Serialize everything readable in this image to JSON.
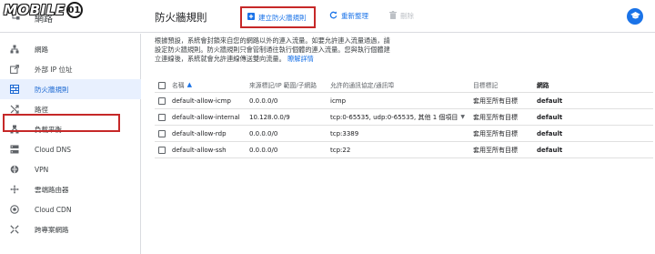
{
  "watermark": {
    "text": "MOBILE",
    "suffix": "01"
  },
  "nav": {
    "header_label": "網路",
    "items": [
      {
        "label": "網路",
        "icon": "network-icon"
      },
      {
        "label": "外部 IP 位址",
        "icon": "external-ip-icon"
      },
      {
        "label": "防火牆規則",
        "icon": "firewall-icon",
        "active": true
      },
      {
        "label": "路徑",
        "icon": "routes-icon"
      },
      {
        "label": "負載平衡",
        "icon": "load-balancing-icon"
      },
      {
        "label": "Cloud DNS",
        "icon": "cloud-dns-icon"
      },
      {
        "label": "VPN",
        "icon": "vpn-icon"
      },
      {
        "label": "雲端路由器",
        "icon": "cloud-router-icon"
      },
      {
        "label": "Cloud CDN",
        "icon": "cloud-cdn-icon"
      },
      {
        "label": "跨專案網路",
        "icon": "shared-vpc-icon"
      }
    ]
  },
  "header": {
    "title": "防火牆規則",
    "create_label": "建立防火牆規則",
    "refresh_label": "重新整理",
    "delete_label": "刪除"
  },
  "description": {
    "text": "根據預設，系統會封鎖來自您的網路以外的連入流量。如要允許連入流量通過，請設定防火牆規則。防火牆規則只會管制通往執行個體的連入流量。您與執行個體建立連線後，系統就會允許連線傳送雙向流量。",
    "link": "瞭解詳情"
  },
  "table": {
    "headers": {
      "name": "名稱",
      "source": "來源標記/IP 範圍/子網路",
      "protocols": "允許的通訊協定/通訊埠",
      "target": "目標標記",
      "network": "網路"
    },
    "rows": [
      {
        "name": "default-allow-icmp",
        "source": "0.0.0.0/0",
        "protocols": "icmp",
        "target": "套用至所有目標",
        "network": "default"
      },
      {
        "name": "default-allow-internal",
        "source": "10.128.0.0/9",
        "protocols": "tcp:0-65535, udp:0-65535, 其他 1 個項目",
        "target": "套用至所有目標",
        "network": "default"
      },
      {
        "name": "default-allow-rdp",
        "source": "0.0.0.0/0",
        "protocols": "tcp:3389",
        "target": "套用至所有目標",
        "network": "default"
      },
      {
        "name": "default-allow-ssh",
        "source": "0.0.0.0/0",
        "protocols": "tcp:22",
        "target": "套用至所有目標",
        "network": "default"
      }
    ]
  },
  "colors": {
    "accent": "#1a73e8",
    "highlight_border": "#c62828",
    "active_bg": "#e8f0fe"
  }
}
